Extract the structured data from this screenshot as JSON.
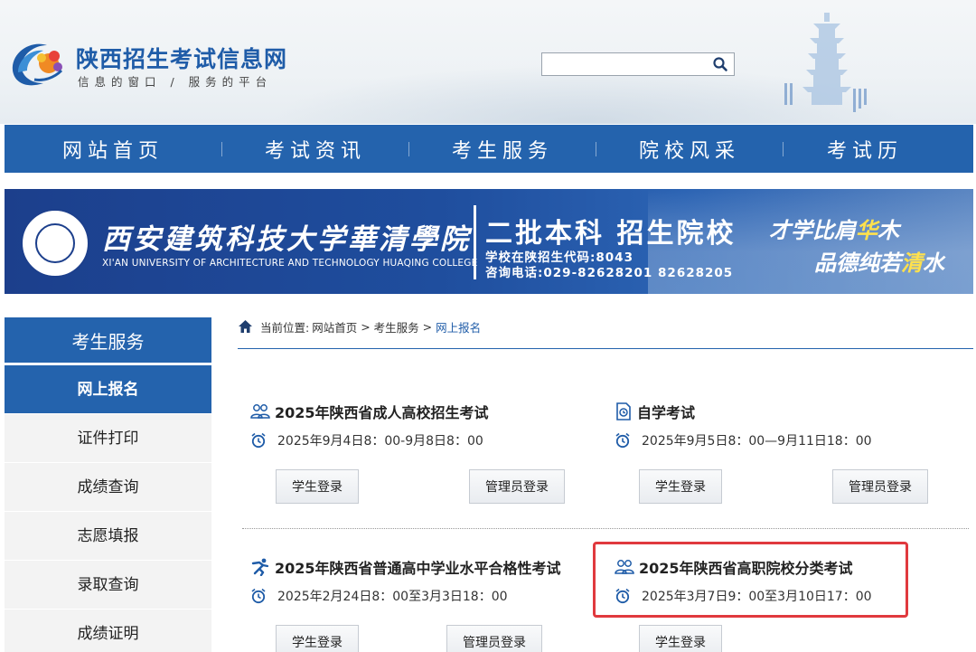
{
  "header": {
    "site_title": "陕西招生考试信息网",
    "slogan": "信息的窗口 / 服务的平台",
    "search": {
      "value": "",
      "placeholder": ""
    },
    "icons": {
      "logo": "colorful-bird-logo",
      "search": "search-icon",
      "decoration": "pagoda-illustration"
    }
  },
  "nav": {
    "items": [
      {
        "label": "网站首页"
      },
      {
        "label": "考试资讯"
      },
      {
        "label": "考生服务"
      },
      {
        "label": "院校风采"
      },
      {
        "label": "考试历"
      }
    ]
  },
  "banner": {
    "school_cn": "西安建筑科技大学華清學院",
    "school_en": "XI'AN UNIVERSITY OF ARCHITECTURE AND TECHNOLOGY HUAQING COLLEGE",
    "headline": "二批本科 招生院校",
    "line1": "学校在陕招生代码:8043",
    "line2": "咨询电话:029-82628201 82628205",
    "motto1_a": "才学比肩",
    "motto1_hl": "华",
    "motto1_b": "木",
    "motto2_a": "品德纯若",
    "motto2_hl": "清",
    "motto2_b": "水"
  },
  "sidebar": {
    "title": "考生服务",
    "items": [
      {
        "label": "网上报名",
        "active": true
      },
      {
        "label": "证件打印"
      },
      {
        "label": "成绩查询"
      },
      {
        "label": "志愿填报"
      },
      {
        "label": "录取查询"
      },
      {
        "label": "成绩证明"
      }
    ]
  },
  "breadcrumb": {
    "prefix": "当前位置:",
    "home": "网站首页",
    "sep": " > ",
    "section": "考生服务",
    "current": "网上报名"
  },
  "exams": [
    {
      "title": "2025年陕西省成人高校招生考试",
      "time": "2025年9月4日8：00-9月8日8：00",
      "icon": "people-icon",
      "buttons": [
        "学生登录",
        "管理员登录"
      ]
    },
    {
      "title": "自学考试",
      "time": "2025年9月5日8：00—9月11日18：00",
      "icon": "document-icon",
      "buttons": [
        "学生登录",
        "管理员登录"
      ]
    },
    {
      "title": "2025年陕西省普通高中学业水平合格性考试",
      "time": "2025年2月24日8：00至3月3日18：00",
      "icon": "runner-icon",
      "buttons": [
        "学生登录",
        "管理员登录"
      ]
    },
    {
      "title": "2025年陕西省高职院校分类考试",
      "time": "2025年3月7日9：00至3月10日17：00",
      "icon": "people-icon",
      "buttons": [
        "学生登录"
      ]
    }
  ],
  "colors": {
    "primary": "#2463ad",
    "highlight_border": "#e0393e",
    "banner": "#1f4e9e"
  }
}
